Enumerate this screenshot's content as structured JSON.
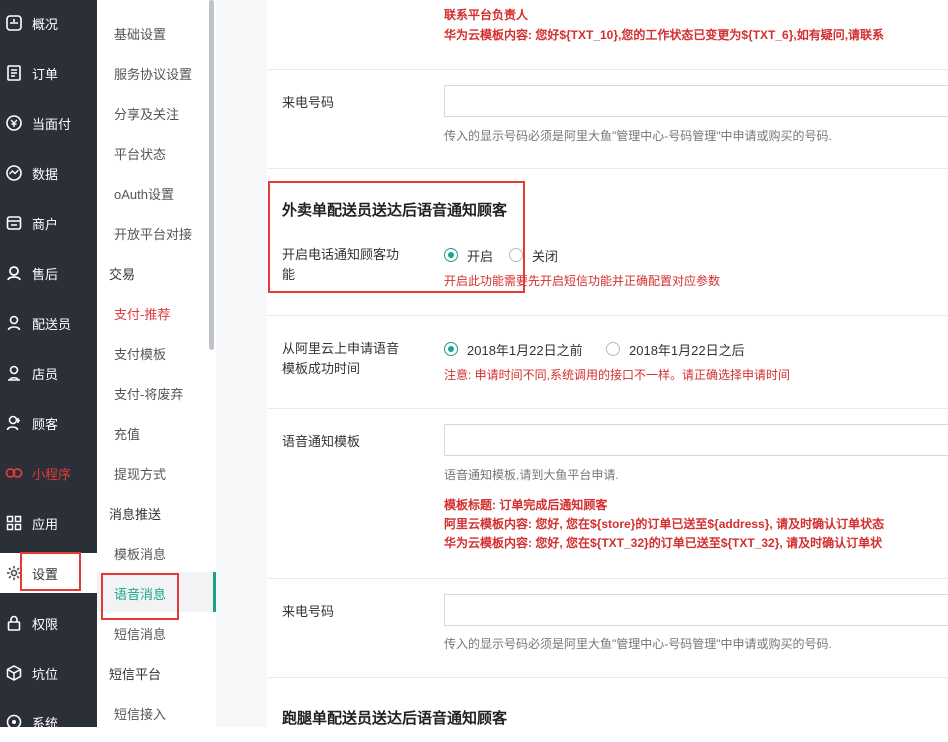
{
  "nav_primary": [
    {
      "icon": "overview-icon",
      "label": "概况"
    },
    {
      "icon": "order-icon",
      "label": "订单"
    },
    {
      "icon": "pay-icon",
      "label": "当面付"
    },
    {
      "icon": "data-icon",
      "label": "数据"
    },
    {
      "icon": "shop-icon",
      "label": "商户"
    },
    {
      "icon": "aftersale-icon",
      "label": "售后"
    },
    {
      "icon": "courier-icon",
      "label": "配送员"
    },
    {
      "icon": "clerk-icon",
      "label": "店员"
    },
    {
      "icon": "customer-icon",
      "label": "顾客"
    },
    {
      "icon": "miniprogram-icon",
      "label": "小程序"
    },
    {
      "icon": "apps-icon",
      "label": "应用"
    },
    {
      "icon": "gear-icon",
      "label": "设置"
    },
    {
      "icon": "lock-icon",
      "label": "权限"
    },
    {
      "icon": "cube-icon",
      "label": "坑位"
    },
    {
      "icon": "system-icon",
      "label": "系统"
    }
  ],
  "nav_secondary": [
    {
      "label": "基础设置",
      "kind": "item"
    },
    {
      "label": "服务协议设置",
      "kind": "item"
    },
    {
      "label": "分享及关注",
      "kind": "item"
    },
    {
      "label": "平台状态",
      "kind": "item"
    },
    {
      "label": "oAuth设置",
      "kind": "item"
    },
    {
      "label": "开放平台对接",
      "kind": "item"
    },
    {
      "label": "交易",
      "kind": "group"
    },
    {
      "label": "支付-推荐",
      "kind": "item"
    },
    {
      "label": "支付模板",
      "kind": "item"
    },
    {
      "label": "支付-将废弃",
      "kind": "item"
    },
    {
      "label": "充值",
      "kind": "item"
    },
    {
      "label": "提现方式",
      "kind": "item"
    },
    {
      "label": "消息推送",
      "kind": "group"
    },
    {
      "label": "模板消息",
      "kind": "item"
    },
    {
      "label": "语音消息",
      "kind": "item"
    },
    {
      "label": "短信消息",
      "kind": "item"
    },
    {
      "label": "短信平台",
      "kind": "group"
    },
    {
      "label": "短信接入",
      "kind": "item"
    }
  ],
  "top_block": {
    "line1": "联系平台负责人",
    "line2": "华为云模板内容: 您好${TXT_10},您的工作状态已变更为${TXT_6},如有疑问,请联系"
  },
  "caller_1": {
    "label": "来电号码",
    "hint": "传入的显示号码必须是阿里大鱼\"管理中心-号码管理\"中申请或购买的号码."
  },
  "takeout_section": {
    "title": "外卖单配送员送达后语音通知顾客",
    "switch_label_1": "开启电话通知顾客功",
    "switch_label_2": "能",
    "option_on": "开启",
    "option_off": "关闭",
    "warning": "开启此功能需要先开启短信功能并正确配置对应参数"
  },
  "apply_time": {
    "label_1": "从阿里云上申请语音",
    "label_2": "模板成功时间",
    "option_before": "2018年1月22日之前",
    "option_after": "2018年1月22日之后",
    "warning": "注意: 申请时间不同,系统调用的接口不一样。请正确选择申请时间"
  },
  "voice_template": {
    "label": "语音通知模板",
    "hint": "语音通知模板,请到大鱼平台申请.",
    "title_line": "模板标题: 订单完成后通知顾客",
    "aliyun_line": "阿里云模板内容: 您好, 您在${store}的订单已送至${address}, 请及时确认订单状态",
    "huawei_line": "华为云模板内容: 您好, 您在${TXT_32}的订单已送至${TXT_32}, 请及时确认订单状"
  },
  "caller_2": {
    "label": "来电号码",
    "hint": "传入的显示号码必须是阿里大鱼\"管理中心-号码管理\"中申请或购买的号码."
  },
  "errand_section": {
    "title": "跑腿单配送员送达后语音通知顾客"
  },
  "colors": {
    "accent": "#1aa38a",
    "warning": "#d32f2f",
    "sidebar": "#2b2f38"
  }
}
